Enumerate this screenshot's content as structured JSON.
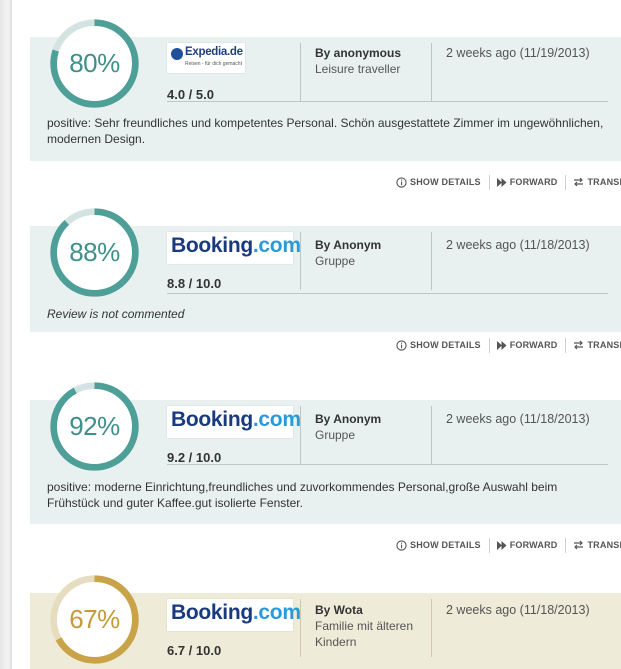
{
  "actions": {
    "show_details": "SHOW DETAILS",
    "forward": "FORWARD",
    "translate": "TRANSLA"
  },
  "reviews": [
    {
      "percent_label": "80%",
      "percent_value": 80,
      "theme": "teal",
      "ring_color": "#4e9f97",
      "track_color": "#d3e3e1",
      "source": "Expedia.de",
      "source_subtitle": "Reisen - für dich gemacht",
      "score": "4.0 / 5.0",
      "author": "By anonymous",
      "author_type": "Leisure traveller",
      "date": "2 weeks ago (11/19/2013)",
      "comment": "positive: Sehr freundliches und kompetentes Personal. Schön ausgestattete Zimmer im ungewöhnlichen, modernen Design."
    },
    {
      "percent_label": "88%",
      "percent_value": 88,
      "theme": "teal",
      "ring_color": "#4e9f97",
      "track_color": "#d3e3e1",
      "source": "Booking",
      "source_suffix": ".com",
      "score": "8.8 / 10.0",
      "author": "By Anonym",
      "author_type": "Gruppe",
      "date": "2 weeks ago (11/18/2013)",
      "comment": "Review is not commented"
    },
    {
      "percent_label": "92%",
      "percent_value": 92,
      "theme": "teal",
      "ring_color": "#4e9f97",
      "track_color": "#d3e3e1",
      "source": "Booking",
      "source_suffix": ".com",
      "score": "9.2 / 10.0",
      "author": "By Anonym",
      "author_type": "Gruppe",
      "date": "2 weeks ago (11/18/2013)",
      "comment": "positive: moderne Einrichtung,freundliches und zuvorkommendes Personal,große Auswahl beim Frühstück und guter Kaffee.gut isolierte Fenster."
    },
    {
      "percent_label": "67%",
      "percent_value": 67,
      "theme": "gold",
      "ring_color": "#c9a348",
      "track_color": "#e6dcc0",
      "source": "Booking",
      "source_suffix": ".com",
      "score": "6.7 / 10.0",
      "author": "By Wota",
      "author_type": "Familie mit älteren Kindern",
      "date": "2 weeks ago (11/18/2013)",
      "comment": ""
    }
  ]
}
